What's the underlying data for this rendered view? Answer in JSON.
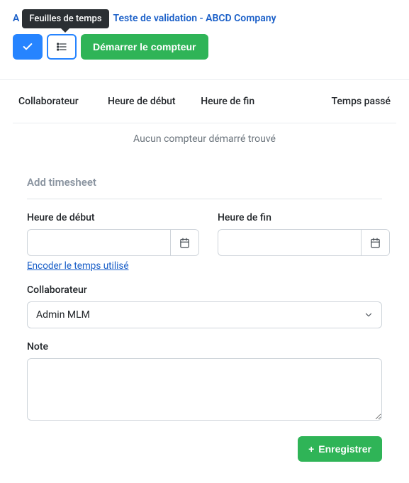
{
  "header": {
    "lead": "A",
    "tooltip": "Feuilles de temps",
    "title": "Teste de validation - ABCD Company"
  },
  "toolbar": {
    "start_timer": "Démarrer le compteur"
  },
  "table": {
    "headers": {
      "collaborator": "Collaborateur",
      "start": "Heure de début",
      "end": "Heure de fin",
      "spent": "Temps passé"
    },
    "empty": "Aucun compteur démarré trouvé"
  },
  "form": {
    "title": "Add timesheet",
    "start_label": "Heure de début",
    "end_label": "Heure de fin",
    "encode_link": "Encoder le temps utilisé",
    "collaborator_label": "Collaborateur",
    "collaborator_value": "Admin MLM",
    "note_label": "Note",
    "save": "Enregistrer"
  },
  "colors": {
    "primary": "#2684ff",
    "success": "#2fb457",
    "link": "#1a5fc8"
  }
}
